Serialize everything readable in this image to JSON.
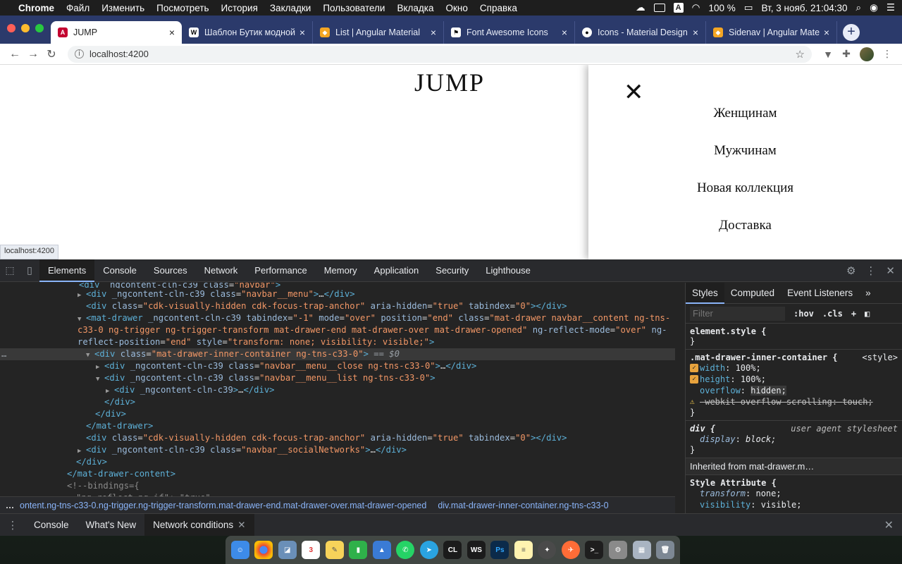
{
  "menubar": {
    "app": "Chrome",
    "items": [
      "Файл",
      "Изменить",
      "Посмотреть",
      "История",
      "Закладки",
      "Пользователи",
      "Вкладка",
      "Окно",
      "Справка"
    ],
    "input_lang": "A",
    "battery": "100 %",
    "datetime": "Вт, 3 нояб.  21:04:30"
  },
  "browser": {
    "tabs": [
      {
        "title": "JUMP",
        "icon": "angular-icon",
        "color": "#c3002f",
        "active": true
      },
      {
        "title": "Шаблон Бутик модной од",
        "icon": "wix-icon",
        "color": "#ffffff"
      },
      {
        "title": "List | Angular Material",
        "icon": "angular-material-icon",
        "color": "#f5a623"
      },
      {
        "title": "Font Awesome Icons",
        "icon": "flag-icon",
        "color": "#228ae6"
      },
      {
        "title": "Icons - Material Design",
        "icon": "github-icon",
        "color": "#ffffff"
      },
      {
        "title": "Sidenav | Angular Material",
        "icon": "angular-material-icon",
        "color": "#f5a623"
      }
    ],
    "url": "localhost:4200",
    "status_url": "localhost:4200"
  },
  "page": {
    "brand": "JUMP",
    "drawer_close_glyph": "✕",
    "menu": [
      "Женщинам",
      "Мужчинам",
      "Новая коллекция",
      "Доставка"
    ]
  },
  "devtools": {
    "tabs": [
      "Elements",
      "Console",
      "Sources",
      "Network",
      "Performance",
      "Memory",
      "Application",
      "Security",
      "Lighthouse"
    ],
    "active_tab": "Elements",
    "breadcrumbs": [
      "ontent.ng-tns-c33-0.ng-trigger.ng-trigger-transform.mat-drawer-end.mat-drawer-over.mat-drawer-opened",
      "div.mat-drawer-inner-container.ng-tns-c33-0"
    ],
    "styles_tabs": [
      "Styles",
      "Computed",
      "Event Listeners"
    ],
    "filter_placeholder": "Filter",
    "hov": ":hov",
    "cls": ".cls",
    "element_style": "element.style {",
    "rule_selector": ".mat-drawer-inner-container {",
    "rule_source": "<style>",
    "decls": [
      {
        "name": "width",
        "value": "100%;"
      },
      {
        "name": "height",
        "value": "100%;"
      },
      {
        "name": "overflow",
        "value": "hidden;"
      },
      {
        "name": "-webkit-overflow-scrolling",
        "value": "touch;"
      }
    ],
    "ua_selector": "div {",
    "ua_source": "user agent stylesheet",
    "ua_decl": {
      "name": "display",
      "value": "block;"
    },
    "inherited_label": "Inherited from",
    "inherited_link": "mat-drawer.m…",
    "style_attr": "Style Attribute {",
    "style_attr_decls": [
      {
        "name": "transform",
        "value": "none;"
      },
      {
        "name": "visibility",
        "value": "visible;"
      }
    ],
    "bottom_tabs": [
      "Console",
      "What's New",
      "Network conditions"
    ]
  },
  "dock": [
    "Finder",
    "Chrome",
    "Preview",
    "Calendar",
    "Notes",
    "Numbers",
    "Keynote",
    "WhatsApp",
    "Telegram",
    "CLion",
    "WebStorm",
    "Photoshop",
    "Notes",
    "Safari",
    "Postman",
    "Terminal",
    "System Preferences",
    "Screenshot",
    "Trash"
  ]
}
